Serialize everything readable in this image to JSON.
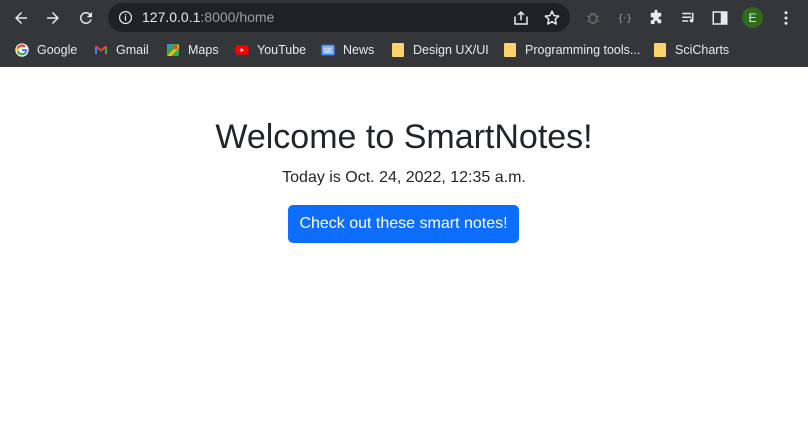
{
  "browser": {
    "url_host": "127.0.0.1",
    "url_rest": ":8000/home",
    "avatar_letter": "E",
    "bookmarks": [
      {
        "label": "Google",
        "icon": "google-icon"
      },
      {
        "label": "Gmail",
        "icon": "gmail-icon"
      },
      {
        "label": "Maps",
        "icon": "maps-icon"
      },
      {
        "label": "YouTube",
        "icon": "youtube-icon"
      },
      {
        "label": "News",
        "icon": "news-icon"
      },
      {
        "label": "Design UX/UI",
        "icon": "folder-icon"
      },
      {
        "label": "Programming tools...",
        "icon": "folder-icon"
      },
      {
        "label": "SciCharts",
        "icon": "folder-icon"
      }
    ],
    "more_label": "»"
  },
  "page": {
    "title": "Welcome to SmartNotes!",
    "date_text": "Today is Oct. 24, 2022, 12:35 a.m.",
    "cta_label": "Check out these smart notes!",
    "cta_color": "#0d6efd"
  }
}
